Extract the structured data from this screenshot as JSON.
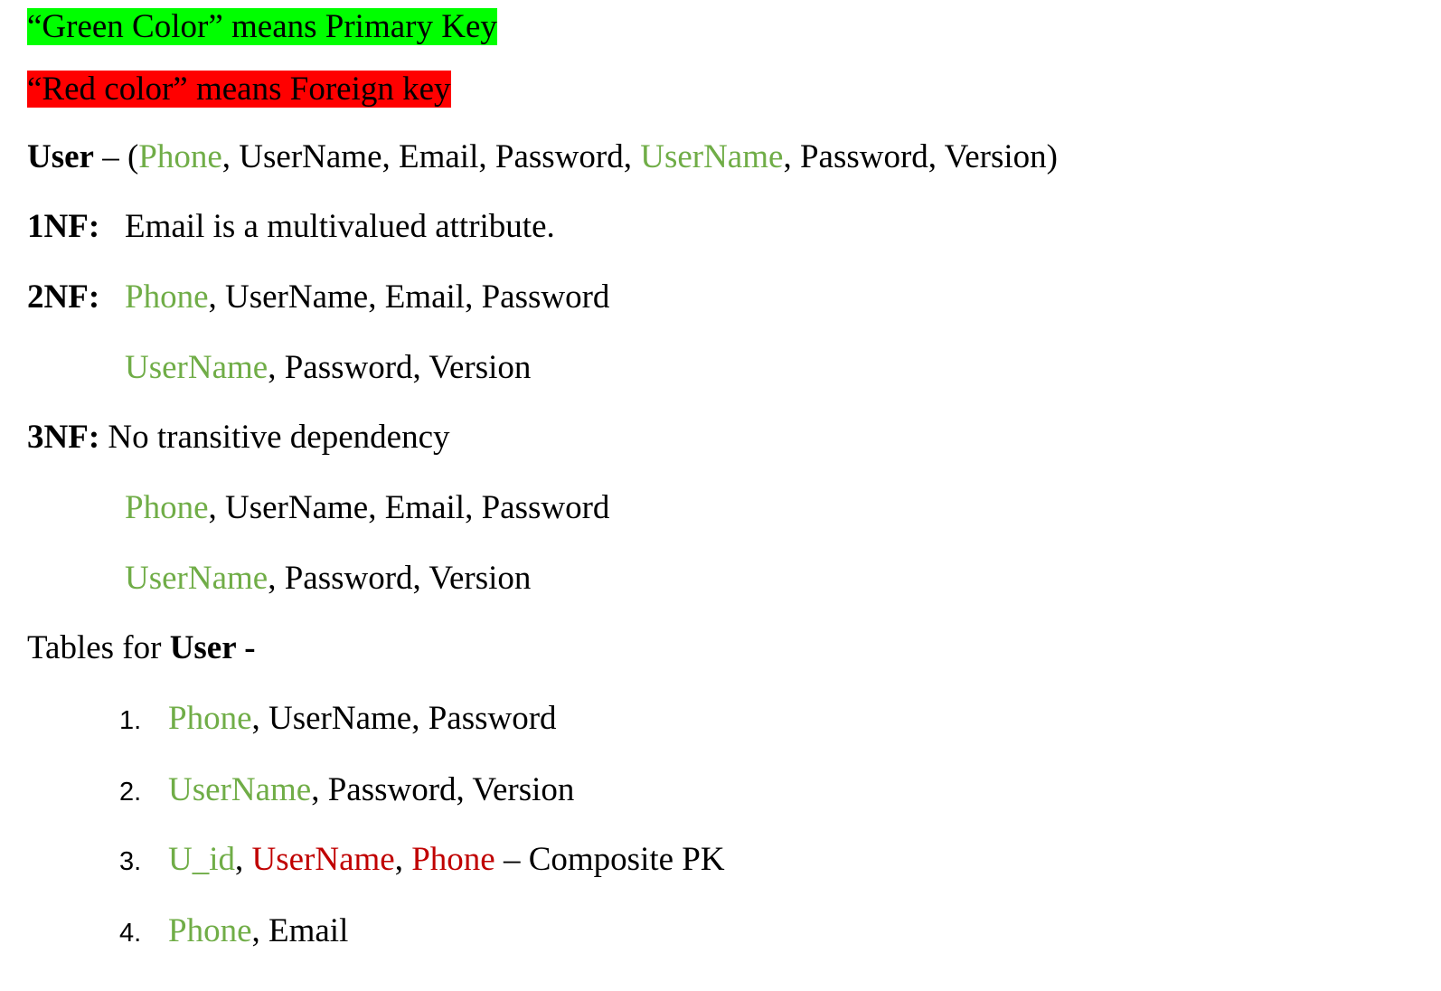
{
  "legend": {
    "green": "“Green Color” means Primary Key",
    "red": "“Red color” means Foreign key"
  },
  "user_def": {
    "label": "User",
    "dash": " – (",
    "phone": "Phone",
    "sep1": ", UserName, Email, Password, ",
    "username": "UserName",
    "rest": ", Password, Version)"
  },
  "nf1": {
    "label": "1NF:",
    "text": "Email is a multivalued attribute."
  },
  "nf2": {
    "label": "2NF:",
    "row1_key": "Phone",
    "row1_rest": ", UserName, Email, Password",
    "row2_key": "UserName",
    "row2_rest": ", Password, Version"
  },
  "nf3": {
    "label": "3NF:",
    "text": " No transitive dependency",
    "row1_key": "Phone",
    "row1_rest": ", UserName, Email, Password",
    "row2_key": "UserName",
    "row2_rest": ", Password, Version"
  },
  "tables": {
    "prefix": "Tables for ",
    "entity": "User -",
    "items": [
      {
        "num": "1.",
        "key": "Phone",
        "rest": ", UserName, Password"
      },
      {
        "num": "2.",
        "key": "UserName",
        "rest": ", Password, Version"
      },
      {
        "num": "3.",
        "key": "U_id",
        "sep1": ", ",
        "fk1": "UserName",
        "sep2": ", ",
        "fk2": "Phone",
        "rest": " – Composite PK"
      },
      {
        "num": "4.",
        "key": "Phone",
        "rest": ", Email"
      }
    ]
  },
  "colors": {
    "primary_key": "#70ad47",
    "foreign_key": "#c00000",
    "highlight_green": "#00ff00",
    "highlight_red": "#ff0000"
  }
}
